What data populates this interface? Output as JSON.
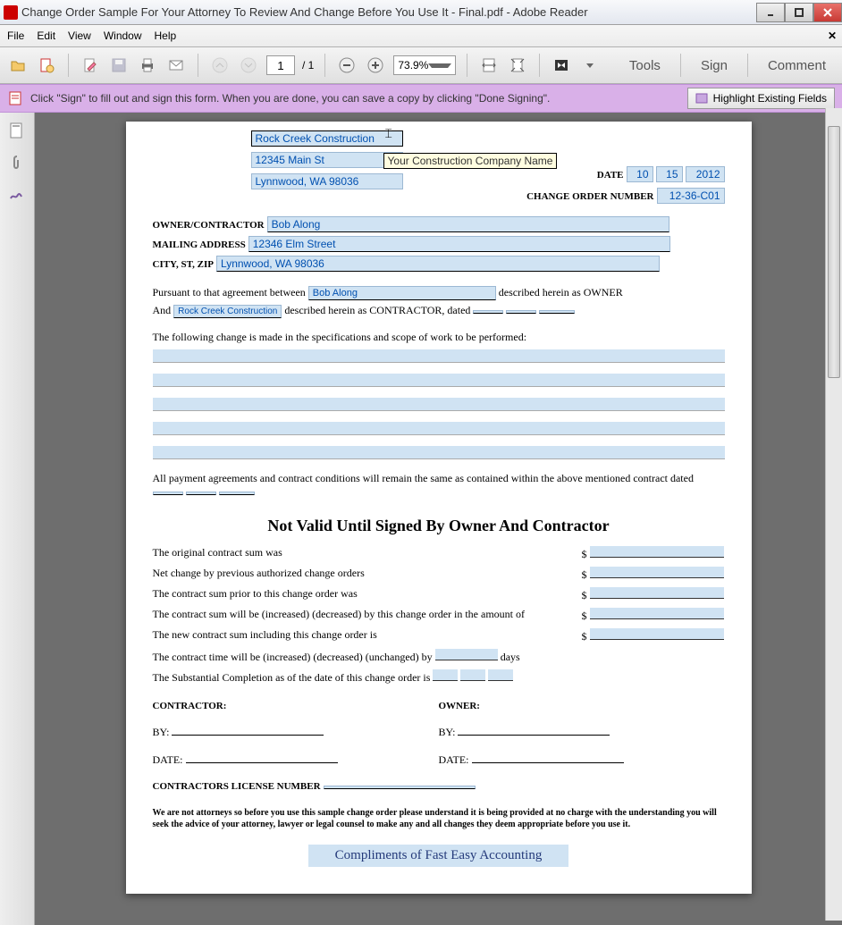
{
  "window": {
    "title": "Change Order Sample For Your Attorney To Review And Change Before You Use It - Final.pdf - Adobe Reader"
  },
  "menu": {
    "file": "File",
    "edit": "Edit",
    "view": "View",
    "window": "Window",
    "help": "Help"
  },
  "toolbar": {
    "page": "1",
    "pages": "/ 1",
    "zoom": "73.9%",
    "tools": "Tools",
    "sign": "Sign",
    "comment": "Comment"
  },
  "signbar": {
    "msg": "Click \"Sign\" to fill out and sign this form. When you are done, you can save a copy by clicking \"Done Signing\".",
    "hl": "Highlight Existing Fields"
  },
  "form": {
    "company": "Rock Creek Construction",
    "addr1": "12345 Main St",
    "addr2": "Lynnwood, WA 98036",
    "tooltip": "Your Construction Company Name",
    "date_lbl": "DATE",
    "date_m": "10",
    "date_d": "15",
    "date_y": "2012",
    "con_lbl": "CHANGE ORDER NUMBER",
    "con": "12-36-C01",
    "oc_lbl": "OWNER/CONTRACTOR",
    "oc": "Bob Along",
    "mail_lbl": "MAILING ADDRESS",
    "mail": "12346 Elm Street",
    "city_lbl": "CITY, ST, ZIP",
    "city": "Lynnwood, WA 98036",
    "p1a": "Pursuant to that agreement between",
    "p1_owner": "Bob Along",
    "p1b": " described herein as OWNER",
    "p2a": "And ",
    "p2_ctr": "Rock Creek Construction",
    "p2b": " described herein as CONTRACTOR, dated ",
    "p3": "The following change is made in the specifications and scope of work to be performed:",
    "p4": "All payment agreements and contract conditions will remain the same as contained within the above mentioned contract dated",
    "h2": "Not Valid Until Signed By Owner And Contractor",
    "s1": "The original contract sum was",
    "s2": "Net change by previous authorized change orders",
    "s3": "The contract sum prior to this change order was",
    "s4": "The contract sum will be (increased) (decreased) by this change order in the amount of",
    "s5": "The new contract sum including this change order is",
    "s6": "The contract time will be (increased) (decreased) (unchanged) by ",
    "s6b": " days",
    "s7": "The Substantial Completion as of the date of this change order is ",
    "ds": "$",
    "contractor": "CONTRACTOR:",
    "owner": "OWNER:",
    "by": "BY:",
    "date": "DATE:",
    "lic": "CONTRACTORS LICENSE NUMBER",
    "disc": "We are not attorneys so before you use this sample change order please understand it is being provided at no charge with the understanding you will seek the advice of your attorney, lawyer or legal counsel to make any and all changes they deem appropriate before you use it.",
    "comp": "Compliments of Fast Easy Accounting"
  }
}
